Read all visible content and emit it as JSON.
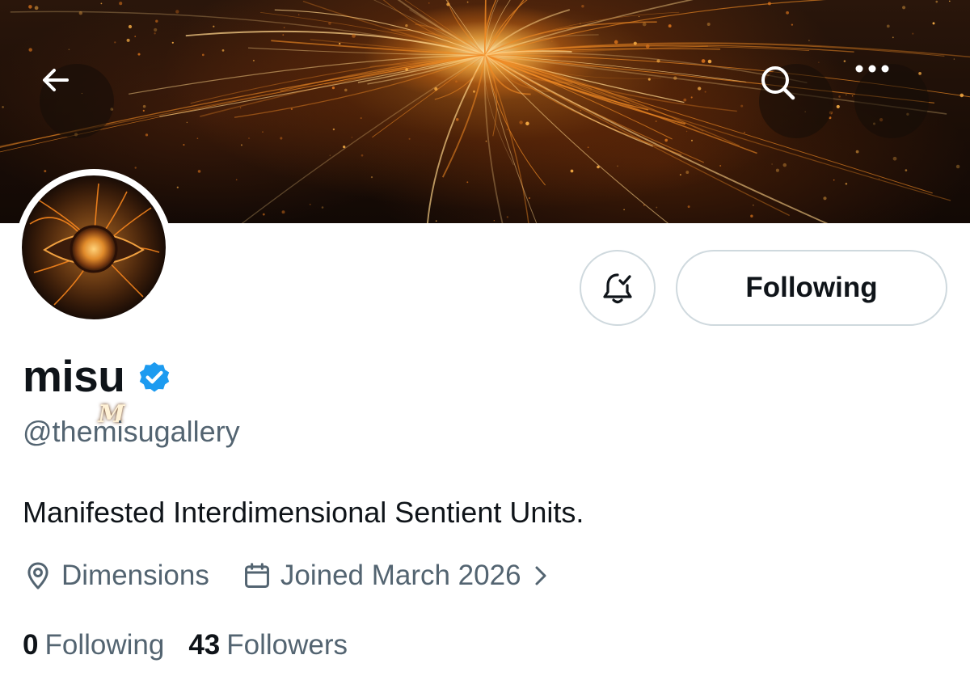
{
  "header": {
    "back_icon": "arrow-left-icon",
    "search_icon": "search-icon",
    "more_icon": "more-horizontal-icon"
  },
  "profile": {
    "display_name": "misu",
    "verified": true,
    "verified_color": "#1d9bf0",
    "handle": "@themisugallery",
    "bio": "Manifested Interdimensional Sentient Units.",
    "avatar_letter": "M",
    "location": "Dimensions",
    "joined": "Joined March 2026"
  },
  "actions": {
    "notify_icon": "bell-check-icon",
    "following_label": "Following"
  },
  "stats": {
    "following_count": "0",
    "following_label": "Following",
    "followers_count": "43",
    "followers_label": "Followers"
  },
  "colors": {
    "text_primary": "#0f1419",
    "text_secondary": "#536471",
    "border": "#cfd9de",
    "banner_accent": "#f5a623"
  }
}
